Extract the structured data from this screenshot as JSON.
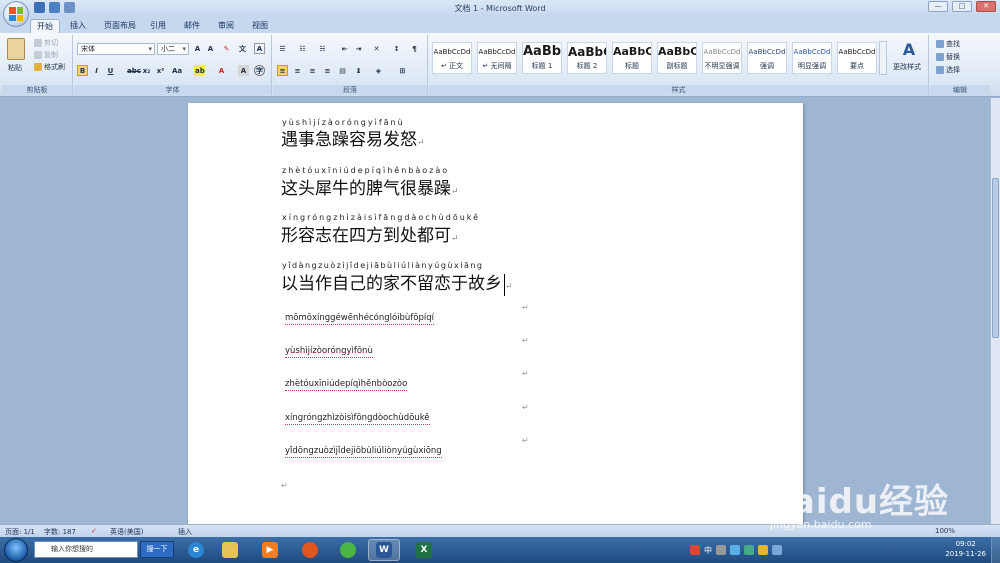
{
  "window": {
    "title": "文档 1 - Microsoft Word",
    "min": "—",
    "max": "□",
    "close": "✕"
  },
  "tabs": [
    "开始",
    "插入",
    "页面布局",
    "引用",
    "邮件",
    "审阅",
    "视图"
  ],
  "ribbon": {
    "clipboard": {
      "paste": "粘贴",
      "cut": "剪切",
      "copy": "复制",
      "format_painter": "格式刷",
      "label": "剪贴板"
    },
    "font": {
      "name": "宋体",
      "size": "小二",
      "label": "字体",
      "bold": "B",
      "italic": "I",
      "underline": "U"
    },
    "paragraph": {
      "label": "段落"
    },
    "styles": {
      "label": "样式",
      "tiles": [
        {
          "sample": "AaBbCcDd",
          "name": "↵ 正文"
        },
        {
          "sample": "AaBbCcDd",
          "name": "↵ 无间隔"
        },
        {
          "sample": "AaBb",
          "name": "标题 1"
        },
        {
          "sample": "AaBbC",
          "name": "标题 2"
        },
        {
          "sample": "AaBbC",
          "name": "标题"
        },
        {
          "sample": "AaBbC",
          "name": "副标题"
        },
        {
          "sample": "AaBbCcDd",
          "name": "不明显强调"
        },
        {
          "sample": "AaBbCcDd",
          "name": "强调"
        },
        {
          "sample": "AaBbCcDd",
          "name": "明显强调"
        },
        {
          "sample": "AaBbCcDd",
          "name": "要点"
        }
      ],
      "change_styles": "更改样式"
    },
    "editing": {
      "label": "编辑",
      "find": "查找",
      "replace": "替换",
      "select": "选择"
    }
  },
  "document": {
    "ruby_blocks": [
      {
        "pinyin": "yùshìjízàoróngyìfānù",
        "hanzi": "遇事急躁容易发怒"
      },
      {
        "pinyin": "zhètóuxīniúdepíqìhěnbàozào",
        "hanzi": "这头犀牛的脾气很暴躁"
      },
      {
        "pinyin": "xíngróngzhìzàisìfāngdàochùdōukě",
        "hanzi": "形容志在四方到处都可"
      },
      {
        "pinyin": "yǐdàngzuòzìjǐdejiābùliúliànyúgùxiāng",
        "hanzi": "以当作自己的家不留恋于故乡"
      }
    ],
    "plain_lines": [
      "mōmōxínggéwēnhécónglóibùfōpíqí",
      "yùshìjízòoróngyìfōnù",
      "zhètóuxīniúdepíqìhěnbòozòo",
      "xíngróngzhìzòisìfōngdòochùdōukě",
      "yǐdōngzuòzìjǐdejiōbùliúliònyúgùxiōng"
    ],
    "para_mark": "↵"
  },
  "status": {
    "page": "页面: 1/1",
    "words": "字数: 187",
    "language": "英语(美国)",
    "mode": "插入",
    "zoom": "100%"
  },
  "taskbar": {
    "search_placeholder": "输入你想搜的",
    "search_button": "搜一下",
    "ime": "中",
    "time": "09:02",
    "date": "2019-11-26"
  },
  "watermark": {
    "brand": "Baidu经验",
    "url": "jingyan.baidu.com"
  },
  "colors": {
    "ribbon_bg": "#dde8f5",
    "workspace_bg": "#9fb6d3",
    "taskbar_bg": "#2a5a92",
    "accent_word": "#2b579a"
  }
}
